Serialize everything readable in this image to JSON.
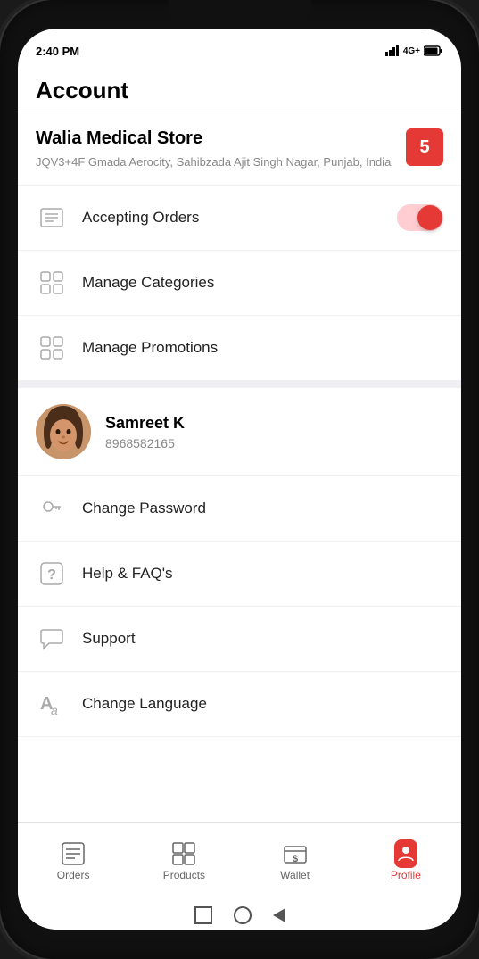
{
  "status_bar": {
    "time": "2:40 PM"
  },
  "header": {
    "title": "Account"
  },
  "store": {
    "name": "Walia Medical Store",
    "address": "JQV3+4F Gmada Aerocity, Sahibzada Ajit Singh Nagar, Punjab, India",
    "badge": "5"
  },
  "menu_items": [
    {
      "label": "Accepting Orders",
      "type": "toggle",
      "toggle_active": true
    },
    {
      "label": "Manage Categories",
      "type": "nav",
      "icon": "grid"
    },
    {
      "label": "Manage Promotions",
      "type": "nav",
      "icon": "grid"
    }
  ],
  "user": {
    "name": "Samreet K",
    "phone": "8968582165"
  },
  "account_menu": [
    {
      "label": "Change Password",
      "icon": "key"
    },
    {
      "label": "Help & FAQ's",
      "icon": "help"
    },
    {
      "label": "Support",
      "icon": "chat"
    },
    {
      "label": "Change Language",
      "icon": "lang"
    }
  ],
  "bottom_nav": [
    {
      "label": "Orders",
      "icon": "orders",
      "active": false
    },
    {
      "label": "Products",
      "icon": "products",
      "active": false
    },
    {
      "label": "Wallet",
      "icon": "wallet",
      "active": false
    },
    {
      "label": "Profile",
      "icon": "profile",
      "active": true
    }
  ]
}
